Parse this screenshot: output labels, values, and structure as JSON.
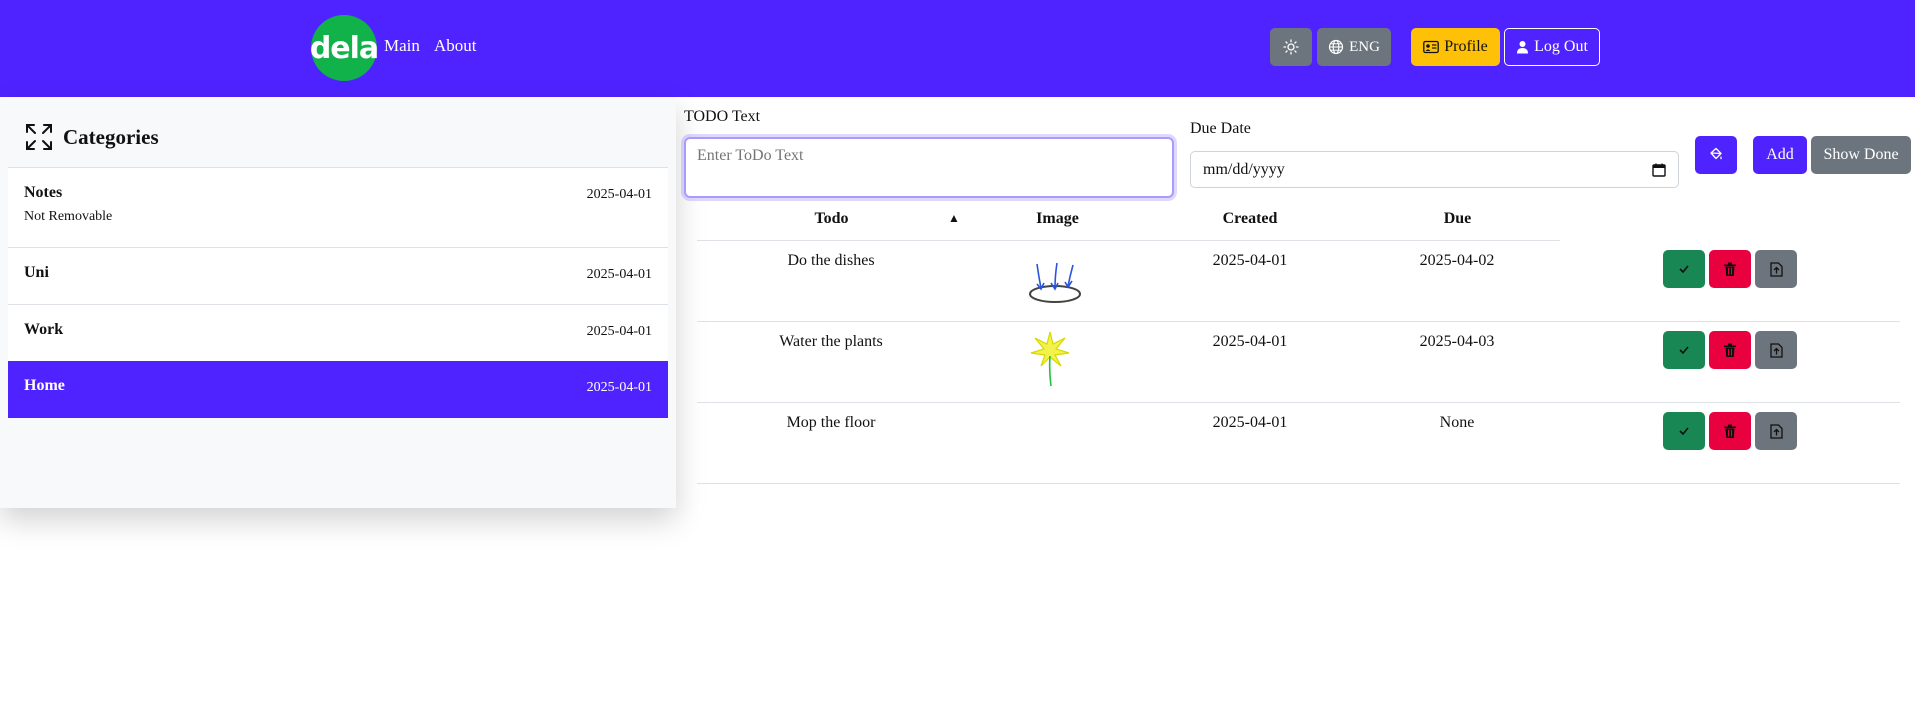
{
  "navbar": {
    "logo_text": "dela",
    "links": [
      "Main",
      "About"
    ],
    "theme_icon": "sun-icon",
    "lang_label": "ENG",
    "profile_label": "Profile",
    "logout_label": "Log Out",
    "colors": {
      "primary": "#4f23ff",
      "logo_bg": "#12b24a",
      "profile_bg": "#ffc107",
      "grey_btn": "#6c757d"
    }
  },
  "sidebar": {
    "title": "Categories",
    "expand_icon": "expand-arrows-icon",
    "items": [
      {
        "name": "Notes",
        "subtitle": "Not Removable",
        "date": "2025-04-01",
        "active": false
      },
      {
        "name": "Uni",
        "subtitle": "",
        "date": "2025-04-01",
        "active": false
      },
      {
        "name": "Work",
        "subtitle": "",
        "date": "2025-04-01",
        "active": false
      },
      {
        "name": "Home",
        "subtitle": "",
        "date": "2025-04-01",
        "active": true
      }
    ]
  },
  "form": {
    "todo_label": "TODO Text",
    "todo_placeholder": "Enter ToDo Text",
    "due_label": "Due Date",
    "due_placeholder": "mm/dd/yyyy",
    "add_label": "Add",
    "show_done_label": "Show Done",
    "paint_icon": "paint-bucket-icon"
  },
  "table": {
    "headers": [
      "Todo",
      "Image",
      "Created",
      "Due"
    ],
    "sort_indicator": "▲",
    "rows": [
      {
        "todo": "Do the dishes",
        "image": "dishes-sketch",
        "created": "2025-04-01",
        "due": "2025-04-02"
      },
      {
        "todo": "Water the plants",
        "image": "flower-sketch",
        "created": "2025-04-01",
        "due": "2025-04-03"
      },
      {
        "todo": "Mop the floor",
        "image": "",
        "created": "2025-04-01",
        "due": "None"
      }
    ],
    "action_icons": [
      "check-icon",
      "trash-icon",
      "upload-icon"
    ]
  }
}
